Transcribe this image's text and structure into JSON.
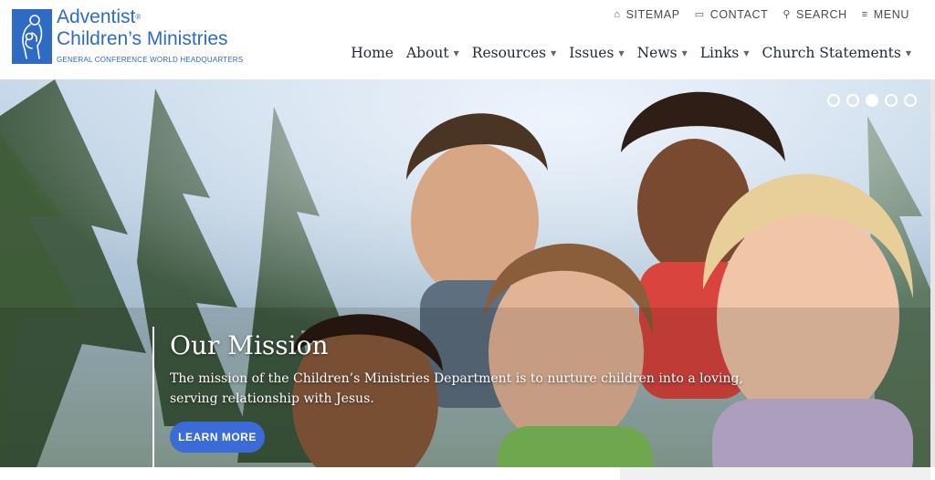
{
  "brand": {
    "title_line1": "Adventist",
    "title_line2": "Children’s Ministries",
    "registered_mark": "®",
    "subtitle": "GENERAL CONFERENCE WORLD HEADQUARTERS",
    "color": "#2f6bc4",
    "logo_icon": "mother-child-logo-icon"
  },
  "utility_nav": [
    {
      "label": "SITEMAP",
      "icon": "home-icon",
      "glyph": "⌂"
    },
    {
      "label": "CONTACT",
      "icon": "chat-icon",
      "glyph": "▭"
    },
    {
      "label": "SEARCH",
      "icon": "search-icon",
      "glyph": "⚲"
    },
    {
      "label": "MENU",
      "icon": "hamburger-icon",
      "glyph": "≡"
    }
  ],
  "main_nav": [
    {
      "label": "Home",
      "has_dropdown": false
    },
    {
      "label": "About",
      "has_dropdown": true
    },
    {
      "label": "Resources",
      "has_dropdown": true
    },
    {
      "label": "Issues",
      "has_dropdown": true
    },
    {
      "label": "News",
      "has_dropdown": true
    },
    {
      "label": "Links",
      "has_dropdown": true
    },
    {
      "label": "Church Statements",
      "has_dropdown": true
    }
  ],
  "hero": {
    "title": "Our Mission",
    "text": "The mission of the Children’s Ministries Department is to nurture children into a loving, serving relationship with Jesus.",
    "button_label": "LEARN MORE",
    "button_color": "#3a6bd6",
    "slides": 5,
    "active_slide": 3
  }
}
